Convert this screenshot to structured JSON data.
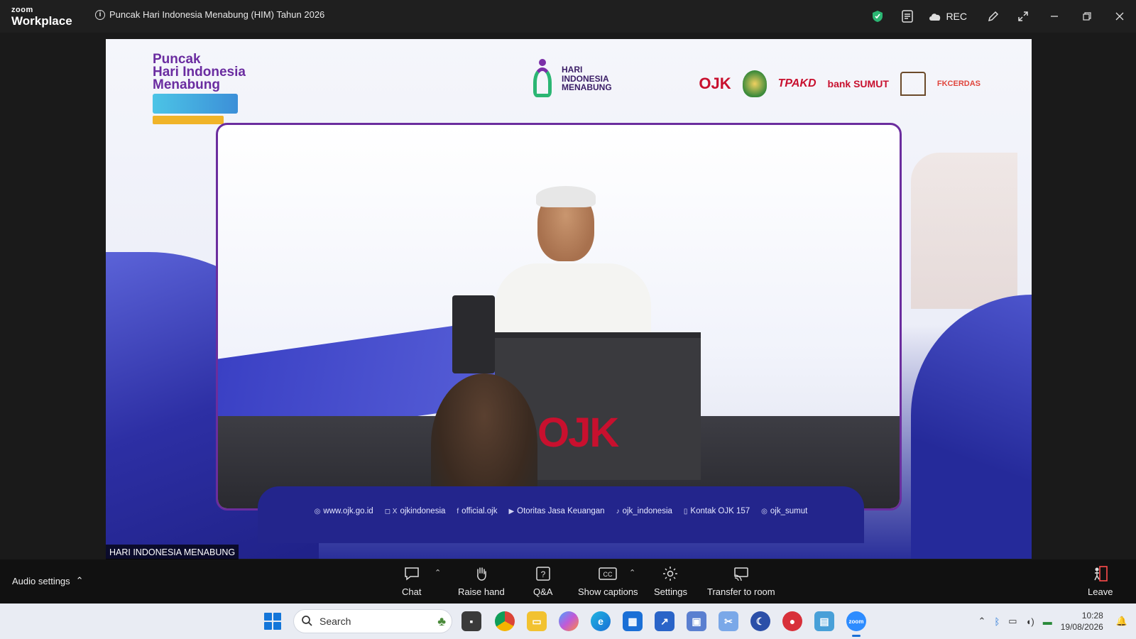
{
  "app": {
    "brand_small": "zoom",
    "brand_large": "Workplace",
    "meeting_title": "Puncak Hari Indonesia Menabung (HIM) Tahun 2026",
    "rec_label": "REC"
  },
  "stage": {
    "him_logo_lines": [
      "Puncak",
      "Hari Indonesia",
      "Menabung"
    ],
    "him_center_lines": [
      "HARI",
      "INDONESIA",
      "MENABUNG"
    ],
    "sponsors": [
      "OJK",
      "TPAKD",
      "bank SUMUT",
      "FKCERDAS"
    ],
    "podium_logo": "OJK",
    "social": [
      {
        "icon": "globe-icon",
        "text": "www.ojk.go.id"
      },
      {
        "icon": "instagram-x-icon",
        "text": "ojkindonesia"
      },
      {
        "icon": "facebook-icon",
        "text": "official.ojk"
      },
      {
        "icon": "youtube-icon",
        "text": "Otoritas Jasa Keuangan"
      },
      {
        "icon": "tiktok-icon",
        "text": "ojk_indonesia"
      },
      {
        "icon": "phone-icon",
        "text": "Kontak OJK 157"
      },
      {
        "icon": "instagram-icon",
        "text": "ojk_sumut"
      }
    ],
    "name_tag": "HARI INDONESIA MENABUNG"
  },
  "controls": {
    "audio_settings": "Audio settings",
    "chat": "Chat",
    "raise_hand": "Raise hand",
    "qa": "Q&A",
    "show_captions": "Show captions",
    "settings": "Settings",
    "transfer": "Transfer to room",
    "leave": "Leave"
  },
  "taskbar": {
    "search_placeholder": "Search",
    "time": "10:28",
    "date": "19/08/2026"
  },
  "colors": {
    "accent_purple": "#6b2d9e",
    "ojk_red": "#c8102e",
    "brand_blue": "#23258c",
    "shield_green": "#2bb673"
  }
}
